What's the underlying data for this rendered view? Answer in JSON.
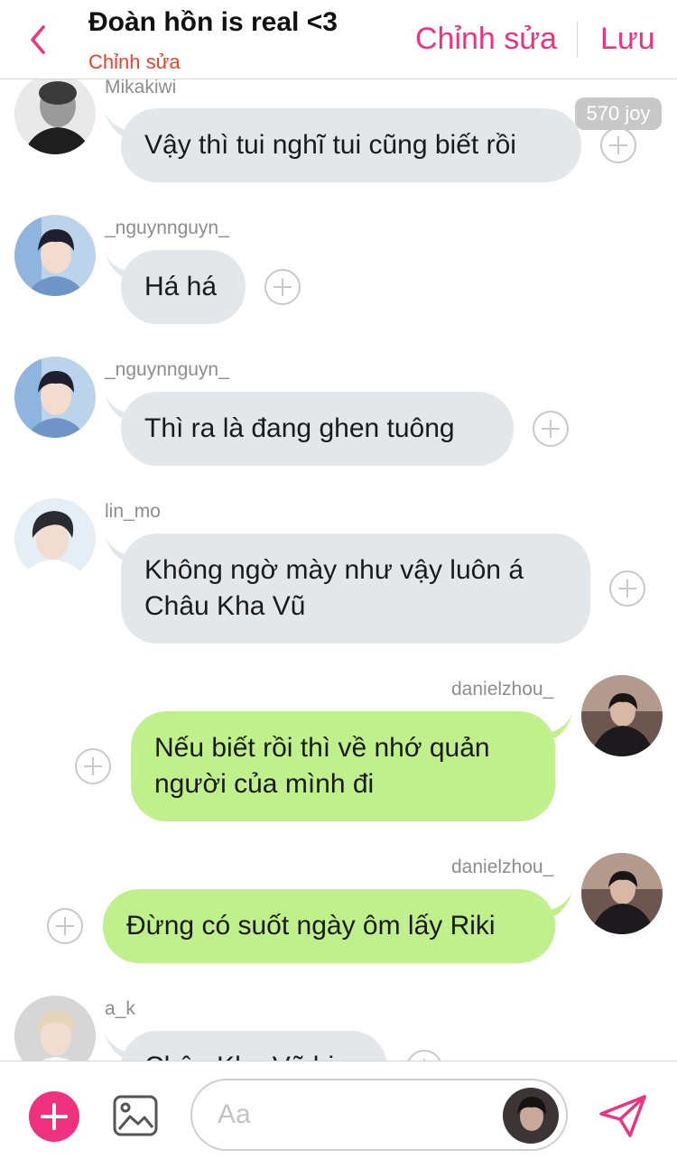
{
  "header": {
    "title": "Đoàn hồn is real <3",
    "subtitle": "Chỉnh sửa",
    "edit_label": "Chỉnh sửa",
    "save_label": "Lưu"
  },
  "badge": "570 joy",
  "messages": [
    {
      "user": "Mikakiwi",
      "lines": [
        "Vậy thì tui nghĩ tui cũng biết rồi"
      ],
      "side": "left"
    },
    {
      "user": "_nguynnguyn_",
      "lines": [
        "Há há"
      ],
      "side": "left"
    },
    {
      "user": "_nguynnguyn_",
      "lines": [
        "Thì ra là đang ghen tuông"
      ],
      "side": "left"
    },
    {
      "user": "lin_mo",
      "lines": [
        "Không ngờ mày như vậy luôn á",
        "Châu Kha Vũ"
      ],
      "side": "left"
    },
    {
      "user": "danielzhou_",
      "lines": [
        "Nếu biết rồi thì về nhớ quản",
        "người của mình đi"
      ],
      "side": "right"
    },
    {
      "user": "danielzhou_",
      "lines": [
        "Đừng có suốt ngày ôm lấy Riki"
      ],
      "side": "right"
    },
    {
      "user": "a_k",
      "lines": [
        "Châu Kha Vũ bi"
      ],
      "side": "left"
    }
  ],
  "composer": {
    "placeholder": "Aa"
  },
  "colors": {
    "accent": "#f0317f",
    "subtitle": "#f23f2b",
    "bubble_left": "#e4e7ea",
    "bubble_right": "#c0f08c"
  },
  "icons": {
    "back": "chevron-left-icon",
    "add": "plus-icon",
    "photo": "image-icon",
    "send": "send-icon",
    "react": "add-reaction-icon"
  }
}
